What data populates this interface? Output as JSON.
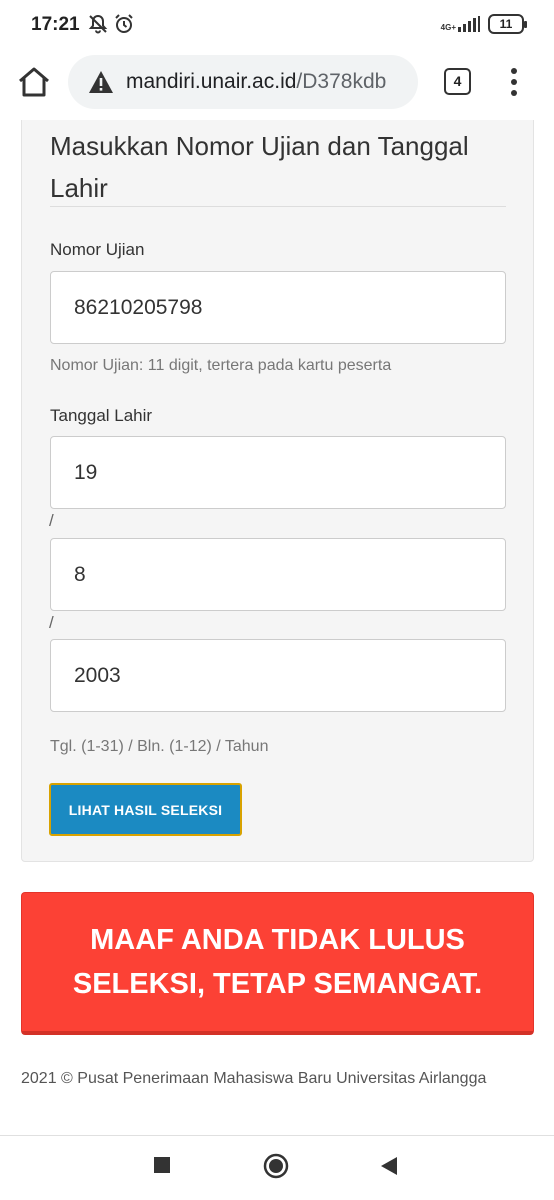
{
  "status_bar": {
    "time": "17:21",
    "network": "4G+",
    "battery": "11"
  },
  "browser": {
    "url_domain": "mandiri.unair.ac.id",
    "url_path": "/D378kdb",
    "tab_count": "4"
  },
  "form": {
    "title": "Masukkan Nomor Ujian dan Tanggal Lahir",
    "exam_number": {
      "label": "Nomor Ujian",
      "value": "86210205798",
      "help": "Nomor Ujian: 11 digit, tertera pada kartu peserta"
    },
    "birth_date": {
      "label": "Tanggal Lahir",
      "day": "19",
      "month": "8",
      "year": "2003",
      "separator": "/",
      "help": "Tgl. (1-31) / Bln. (1-12) / Tahun"
    },
    "submit_label": "LIHAT HASIL SELEKSI"
  },
  "result": {
    "message": "MAAF ANDA TIDAK LULUS SELEKSI, TETAP SEMANGAT.",
    "color": "#fc4135"
  },
  "footer": {
    "text": "2021 © Pusat Penerimaan Mahasiswa Baru Universitas Airlangga"
  },
  "colors": {
    "button": "#1b8ac2",
    "button_border": "#d8a200"
  }
}
